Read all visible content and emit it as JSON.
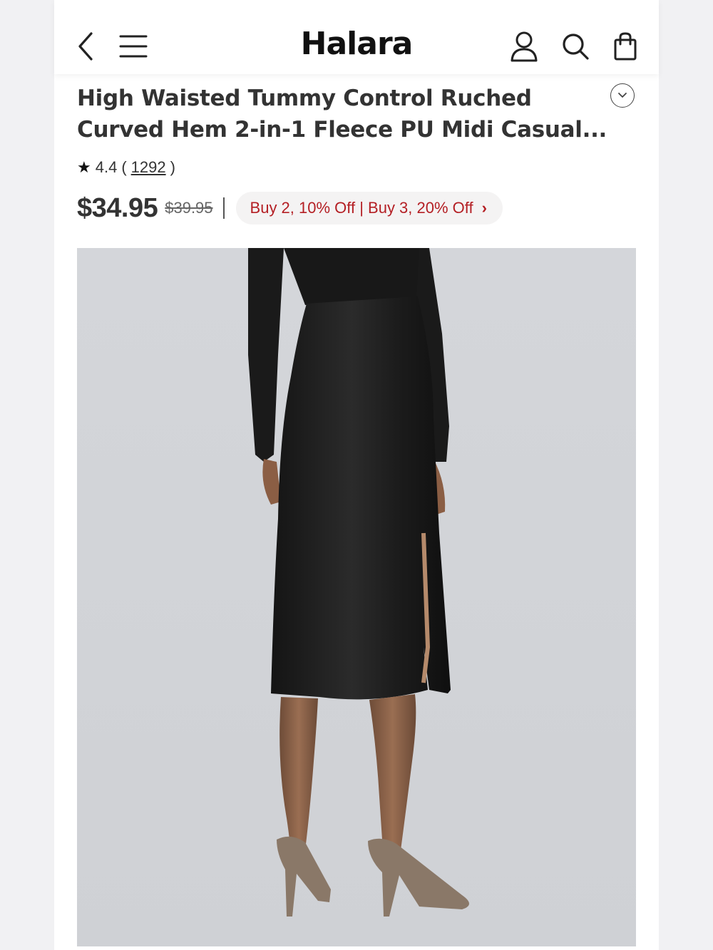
{
  "header": {
    "logo": "Halara",
    "icons": [
      "back-icon",
      "menu-icon",
      "account-icon",
      "search-icon",
      "bag-icon"
    ]
  },
  "product": {
    "title_line1": "High Waisted Tummy Control Ruched",
    "title_line2": "Curved Hem 2-in-1 Fleece PU Midi Casual...",
    "rating": "4.4",
    "paren_open": "(",
    "review_count": "1292",
    "paren_close": ")",
    "price": "$34.95",
    "original_price": "$39.95",
    "promo": "Buy 2, 10% Off | Buy 3, 20% Off"
  },
  "colors": {
    "promo_text": "#b41f24",
    "promo_bg": "#f4f3f3",
    "image_bg": "#d6d8dc",
    "skirt": "#1c1c1c"
  }
}
